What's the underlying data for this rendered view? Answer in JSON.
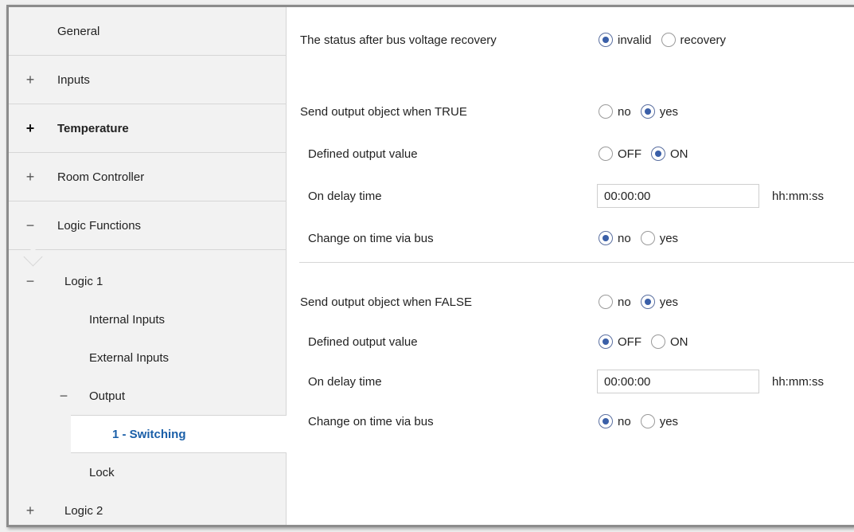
{
  "sidebar": {
    "top_items": [
      {
        "sign": "",
        "label": "General"
      },
      {
        "sign": "+",
        "label": "Inputs"
      },
      {
        "sign": "+",
        "label": "Temperature"
      },
      {
        "sign": "+",
        "label": "Room Controller"
      },
      {
        "sign": "−",
        "label": "Logic Functions"
      }
    ],
    "logic1": {
      "sign": "−",
      "label": "Logic 1"
    },
    "internal_inputs": "Internal Inputs",
    "external_inputs": "External Inputs",
    "output": {
      "sign": "−",
      "label": "Output"
    },
    "switching": "1 - Switching",
    "lock": "Lock",
    "logic2": {
      "sign": "+",
      "label": "Logic 2"
    }
  },
  "main": {
    "bus_recovery": {
      "label": "The status after bus voltage recovery",
      "options": [
        "invalid",
        "recovery"
      ],
      "selected": "invalid"
    },
    "true_section": {
      "send_label": "Send output object when TRUE",
      "send_options": [
        "no",
        "yes"
      ],
      "send_selected": "yes",
      "value_label": "Defined output value",
      "value_options": [
        "OFF",
        "ON"
      ],
      "value_selected": "ON",
      "delay_label": "On delay time",
      "delay_value": "00:00:00",
      "delay_unit": "hh:mm:ss",
      "bus_label": "Change on time via bus",
      "bus_options": [
        "no",
        "yes"
      ],
      "bus_selected": "no"
    },
    "false_section": {
      "send_label": "Send output object when FALSE",
      "send_options": [
        "no",
        "yes"
      ],
      "send_selected": "yes",
      "value_label": "Defined output value",
      "value_options": [
        "OFF",
        "ON"
      ],
      "value_selected": "OFF",
      "delay_label": "On delay time",
      "delay_value": "00:00:00",
      "delay_unit": "hh:mm:ss",
      "bus_label": "Change on time via bus",
      "bus_options": [
        "no",
        "yes"
      ],
      "bus_selected": "no"
    }
  },
  "colors": {
    "accent": "#1a5fa8",
    "sidebar_bg": "#f2f2f2",
    "divider": "#d6d6d6"
  }
}
